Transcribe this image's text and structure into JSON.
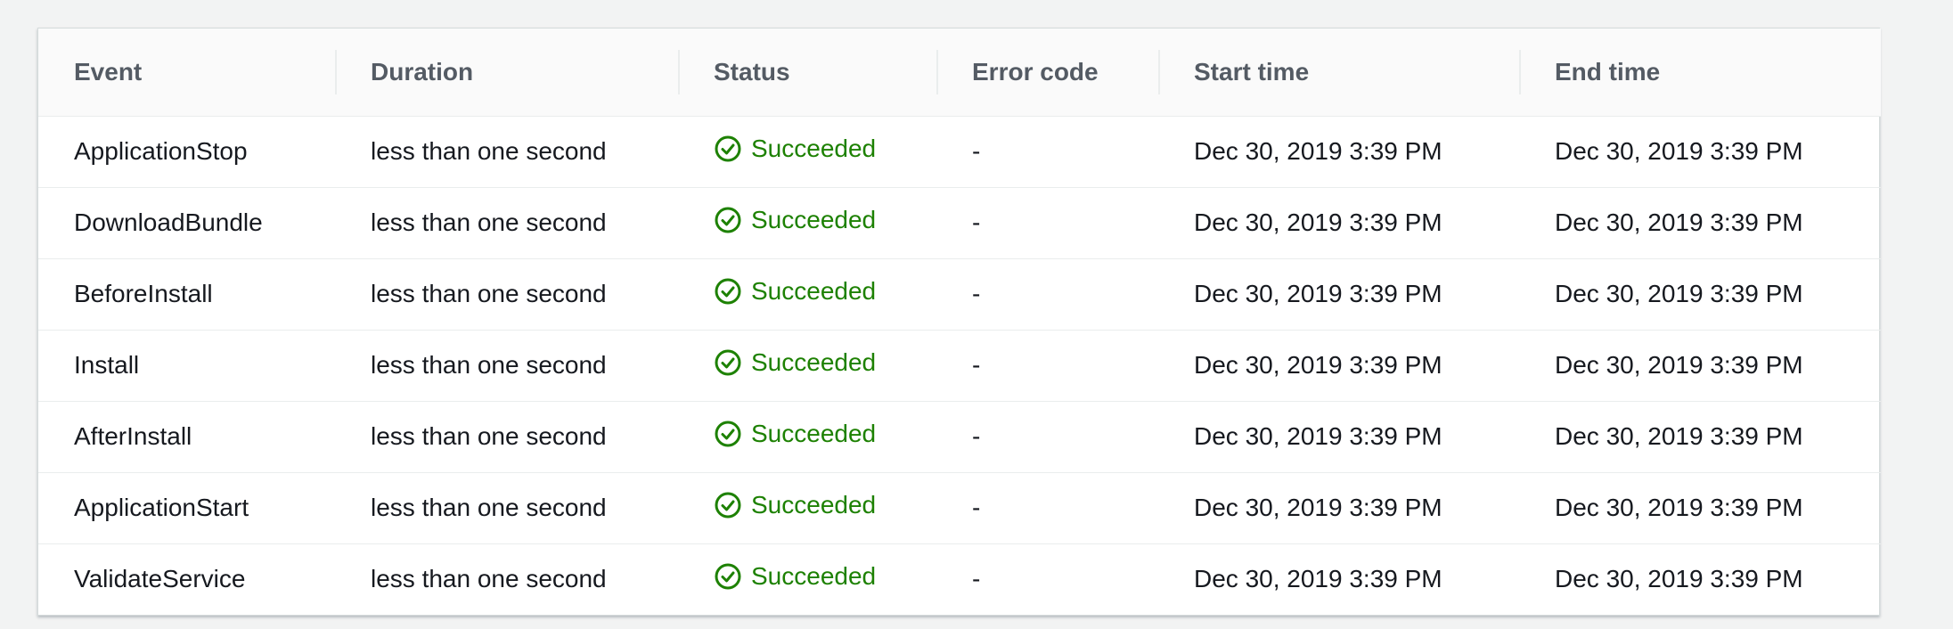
{
  "table": {
    "columns": [
      "Event",
      "Duration",
      "Status",
      "Error code",
      "Start time",
      "End time"
    ],
    "rows": [
      {
        "event": "ApplicationStop",
        "duration": "less than one second",
        "status": "Succeeded",
        "error_code": "-",
        "start_time": "Dec 30, 2019 3:39 PM",
        "end_time": "Dec 30, 2019 3:39 PM"
      },
      {
        "event": "DownloadBundle",
        "duration": "less than one second",
        "status": "Succeeded",
        "error_code": "-",
        "start_time": "Dec 30, 2019 3:39 PM",
        "end_time": "Dec 30, 2019 3:39 PM"
      },
      {
        "event": "BeforeInstall",
        "duration": "less than one second",
        "status": "Succeeded",
        "error_code": "-",
        "start_time": "Dec 30, 2019 3:39 PM",
        "end_time": "Dec 30, 2019 3:39 PM"
      },
      {
        "event": "Install",
        "duration": "less than one second",
        "status": "Succeeded",
        "error_code": "-",
        "start_time": "Dec 30, 2019 3:39 PM",
        "end_time": "Dec 30, 2019 3:39 PM"
      },
      {
        "event": "AfterInstall",
        "duration": "less than one second",
        "status": "Succeeded",
        "error_code": "-",
        "start_time": "Dec 30, 2019 3:39 PM",
        "end_time": "Dec 30, 2019 3:39 PM"
      },
      {
        "event": "ApplicationStart",
        "duration": "less than one second",
        "status": "Succeeded",
        "error_code": "-",
        "start_time": "Dec 30, 2019 3:39 PM",
        "end_time": "Dec 30, 2019 3:39 PM"
      },
      {
        "event": "ValidateService",
        "duration": "less than one second",
        "status": "Succeeded",
        "error_code": "-",
        "start_time": "Dec 30, 2019 3:39 PM",
        "end_time": "Dec 30, 2019 3:39 PM"
      }
    ]
  },
  "colors": {
    "success": "#1d8102",
    "header_text": "#545b64",
    "body_text": "#16191f",
    "page_background": "#f2f3f3"
  },
  "icons": {
    "status_icon": "check-circle-icon"
  }
}
